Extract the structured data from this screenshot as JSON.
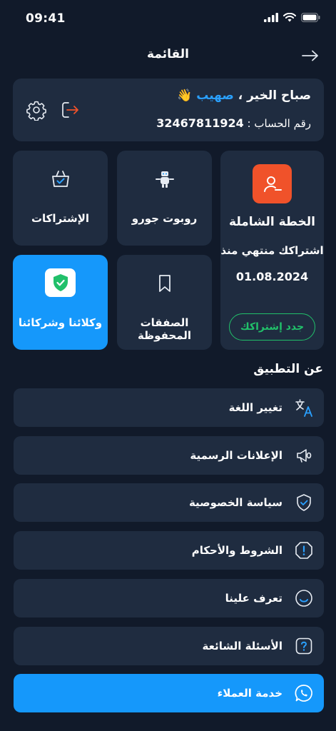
{
  "status": {
    "time": "09:41"
  },
  "header": {
    "title": "القائمة"
  },
  "greeting": {
    "prefix": "صباح الخير ،",
    "name": "صهيب",
    "emoji": "👋",
    "account_label": "رقم الحساب :",
    "account_number": "32467811924"
  },
  "tiles": {
    "plan": {
      "title": "الخطة الشاملة",
      "status": "اشتراكك منتهي منذ",
      "date": "01.08.2024",
      "renew_label": "جدد إشتراكك"
    },
    "robot": {
      "label": "روبوت جورو"
    },
    "subscriptions": {
      "label": "الإشتراكات"
    },
    "saved_deals": {
      "label": "الصفقات المحفوظة"
    },
    "agents": {
      "label": "وكلائنا وشركائنا"
    }
  },
  "about": {
    "title": "عن التطبيق",
    "items": [
      {
        "label": "تغيير اللغة",
        "icon": "translate-icon"
      },
      {
        "label": "الإعلانات الرسمية",
        "icon": "megaphone-icon"
      },
      {
        "label": "سياسة الخصوصية",
        "icon": "shield-check-icon"
      },
      {
        "label": "الشروط والأحكام",
        "icon": "alert-icon"
      },
      {
        "label": "تعرف علينا",
        "icon": "smile-icon"
      },
      {
        "label": "الأسئلة الشائعة",
        "icon": "question-icon"
      },
      {
        "label": "خدمة العملاء",
        "icon": "whatsapp-icon"
      }
    ]
  },
  "colors": {
    "background": "#111a2a",
    "card": "#1f2c40",
    "accent_blue": "#1598fb",
    "name_blue": "#2aa0ff",
    "plan_orange": "#f0522a",
    "renew_green": "#21c06a"
  }
}
